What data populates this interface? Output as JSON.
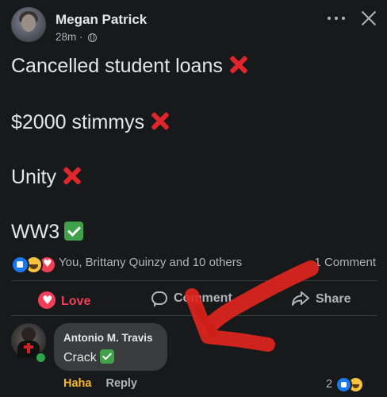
{
  "post": {
    "author": "Megan Patrick",
    "time": "28m",
    "separator": "·",
    "lines": [
      {
        "text": "Cancelled student loans",
        "mark": "cross-mark"
      },
      {
        "text": "$2000 stimmys",
        "mark": "cross-mark"
      },
      {
        "text": "Unity",
        "mark": "cross-mark"
      },
      {
        "text": "WW3",
        "mark": "check-mark"
      }
    ]
  },
  "reactions": {
    "icons": [
      "like-icon",
      "haha-icon",
      "love-icon"
    ],
    "names": "You, Brittany Quinzy and 10 others",
    "comment_count": "1 Comment"
  },
  "actions": {
    "love": "Love",
    "comment": "Comment",
    "share": "Share"
  },
  "comment": {
    "author": "Antonio M. Travis",
    "text": "Crack",
    "haha_label": "Haha",
    "reply_label": "Reply",
    "reaction_count": "2",
    "reaction_icons": [
      "like-icon",
      "haha-icon"
    ]
  },
  "colors": {
    "background": "#18191b",
    "text": "#e4e6eb",
    "secondary_text": "#b0b3b8",
    "love": "#f33e58",
    "haha": "#f7b928",
    "annotation": "#e3261e"
  }
}
